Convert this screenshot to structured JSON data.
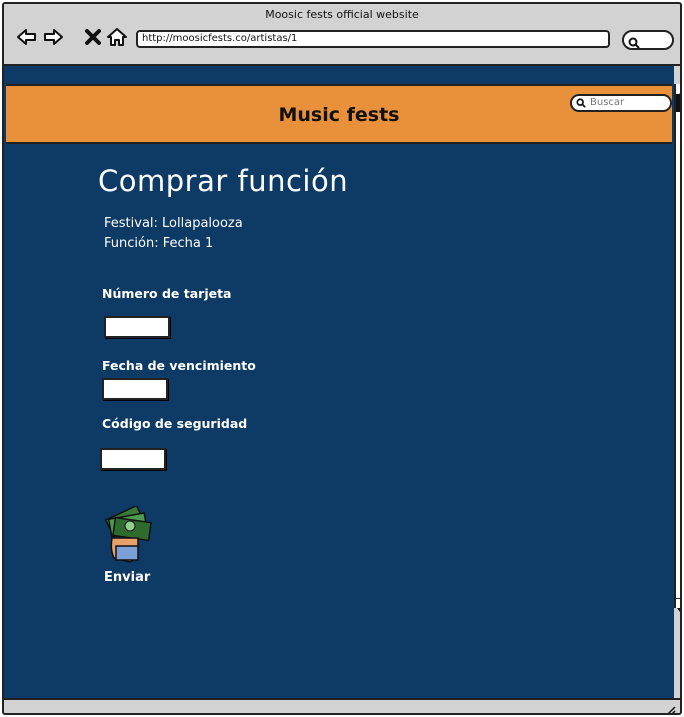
{
  "browser": {
    "window_title": "Moosic fests official website",
    "url": "http://moosicfests.co/artistas/1",
    "icons": [
      "back-icon",
      "forward-icon",
      "close-icon",
      "home-icon",
      "search-icon"
    ]
  },
  "site": {
    "title": "Music fests",
    "search_placeholder": "Buscar",
    "header_color": "#e8913a",
    "background_color": "#0e3a66"
  },
  "page": {
    "heading": "Comprar función",
    "festival_line": "Festival: Lollapalooza",
    "function_line": "Función: Fecha 1",
    "fields": [
      {
        "label": "Número de tarjeta",
        "value": ""
      },
      {
        "label": "Fecha de vencimiento",
        "value": ""
      },
      {
        "label": "Código de seguridad",
        "value": ""
      }
    ],
    "submit_label": "Enviar",
    "submit_icon": "money-hand-icon"
  }
}
